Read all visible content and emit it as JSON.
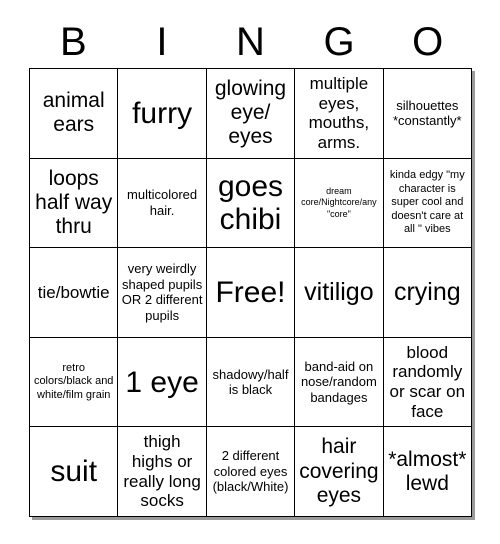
{
  "header": {
    "letters": [
      "B",
      "I",
      "N",
      "G",
      "O"
    ]
  },
  "grid": {
    "rows": 5,
    "columns": 5,
    "cells": [
      {
        "text": "animal ears",
        "size": "fs-lg"
      },
      {
        "text": "furry",
        "size": "fs-xxl"
      },
      {
        "text": "glowing eye/ eyes",
        "size": "fs-lg"
      },
      {
        "text": "multiple eyes, mouths, arms.",
        "size": "fs-md"
      },
      {
        "text": "silhouettes *constantly*",
        "size": "fs-sm"
      },
      {
        "text": "loops half way thru",
        "size": "fs-lg"
      },
      {
        "text": "multicolored hair.",
        "size": "fs-sm"
      },
      {
        "text": "goes chibi",
        "size": "fs-xxl"
      },
      {
        "text": "dream core/Nightcore/any \"core\"",
        "size": "fs-xxs"
      },
      {
        "text": "kinda edgy \"my character is super cool and doesn't care at all \" vibes",
        "size": "fs-xs"
      },
      {
        "text": "tie/bowtie",
        "size": "fs-md"
      },
      {
        "text": "very weirdly shaped pupils OR 2 different pupils",
        "size": "fs-sm"
      },
      {
        "text": "Free!",
        "size": "fs-xxl"
      },
      {
        "text": "vitiligo",
        "size": "fs-xl"
      },
      {
        "text": "crying",
        "size": "fs-xl"
      },
      {
        "text": "retro colors/black and white/film grain",
        "size": "fs-xs"
      },
      {
        "text": "1 eye",
        "size": "fs-xxl"
      },
      {
        "text": "shadowy/half is black",
        "size": "fs-sm"
      },
      {
        "text": "band-aid on nose/random bandages",
        "size": "fs-sm"
      },
      {
        "text": "blood randomly or scar on face",
        "size": "fs-md"
      },
      {
        "text": "suit",
        "size": "fs-xxl"
      },
      {
        "text": "thigh highs or really long socks",
        "size": "fs-md"
      },
      {
        "text": "2 different colored eyes (black/White)",
        "size": "fs-sm"
      },
      {
        "text": "hair covering eyes",
        "size": "fs-lg"
      },
      {
        "text": "*almost* lewd",
        "size": "fs-lg"
      }
    ]
  },
  "colors": {
    "background": "#ffffff",
    "text": "#000000",
    "border": "#000000",
    "shadow": "#9a9a9a"
  }
}
